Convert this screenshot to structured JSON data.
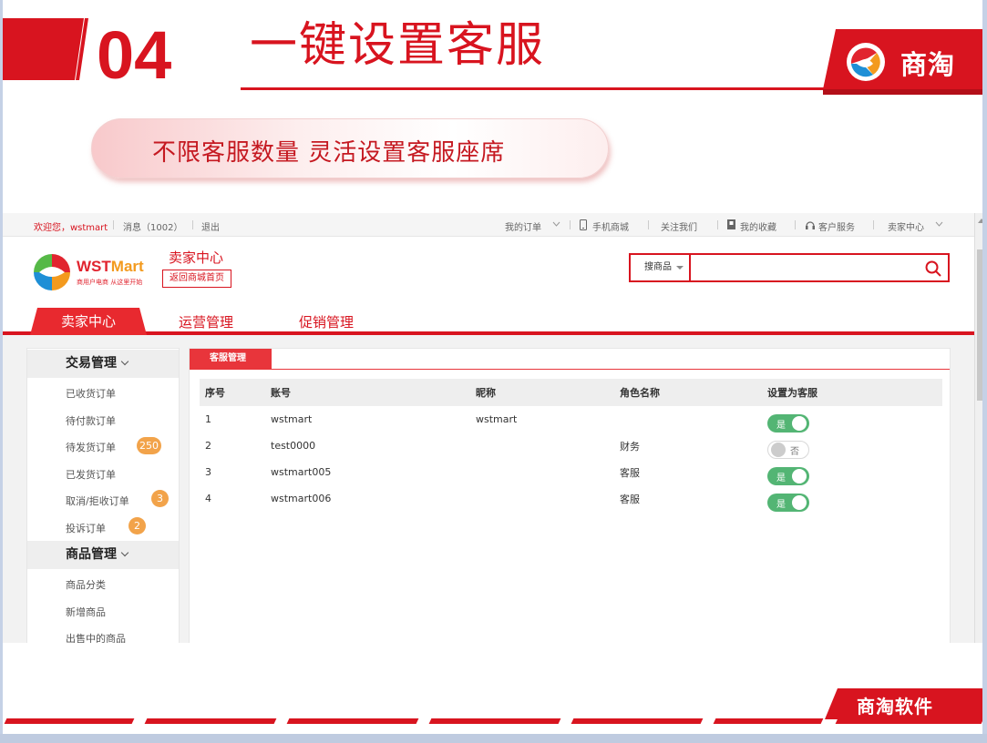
{
  "slide": {
    "number": "04",
    "title": "一键设置客服",
    "subtitle": "不限客服数量 灵活设置客服座席",
    "brand": "商淘",
    "footer_brand": "商淘软件"
  },
  "colors": {
    "brand_red": "#d8141f",
    "toggle_on": "#53b574",
    "badge_orange": "#f2a34a"
  },
  "topbar": {
    "welcome": "欢迎您，wstmart",
    "messages": "消息（1002）",
    "logout": "退出",
    "my_orders": "我的订单",
    "mobile_mall": "手机商城",
    "follow_us": "关注我们",
    "my_favorites": "我的收藏",
    "customer_service": "客户服务",
    "seller_center": "卖家中心"
  },
  "header": {
    "logo_name_a": "WST",
    "logo_name_b": "Mart",
    "slogan": "商用户电商 从这里开始",
    "seller_center": "卖家中心",
    "back_home": "返回商城首页",
    "search_category": "搜商品",
    "search_value": ""
  },
  "nav": {
    "tabs": [
      "卖家中心",
      "运营管理",
      "促销管理"
    ],
    "active": 0
  },
  "sidebar": {
    "groups": [
      {
        "label": "交易管理",
        "items": [
          {
            "label": "已收货订单"
          },
          {
            "label": "待付款订单"
          },
          {
            "label": "待发货订单",
            "badge": "250"
          },
          {
            "label": "已发货订单"
          },
          {
            "label": "取消/拒收订单",
            "badge": "3"
          },
          {
            "label": "投诉订单",
            "badge": "2"
          }
        ]
      },
      {
        "label": "商品管理",
        "items": [
          {
            "label": "商品分类"
          },
          {
            "label": "新增商品"
          },
          {
            "label": "出售中的商品"
          }
        ]
      }
    ]
  },
  "panel": {
    "tab": "客服管理",
    "columns": [
      "序号",
      "账号",
      "昵称",
      "角色名称",
      "设置为客服"
    ],
    "rows": [
      {
        "index": "1",
        "account": "wstmart",
        "nickname": "wstmart",
        "role": "",
        "is_service": true,
        "toggle_label": "是"
      },
      {
        "index": "2",
        "account": "test0000",
        "nickname": "",
        "role": "财务",
        "is_service": false,
        "toggle_label": "否"
      },
      {
        "index": "3",
        "account": "wstmart005",
        "nickname": "",
        "role": "客服",
        "is_service": true,
        "toggle_label": "是"
      },
      {
        "index": "4",
        "account": "wstmart006",
        "nickname": "",
        "role": "客服",
        "is_service": true,
        "toggle_label": "是"
      }
    ]
  }
}
